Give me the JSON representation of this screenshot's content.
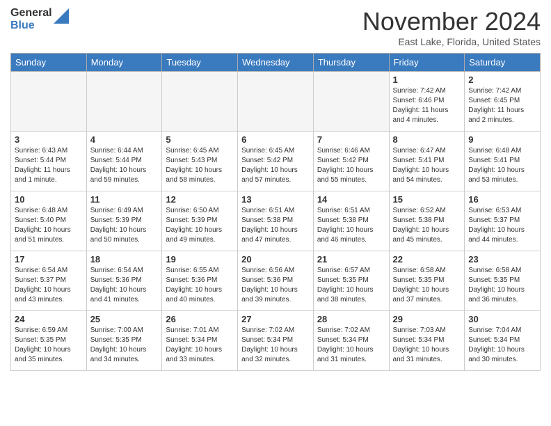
{
  "logo": {
    "general": "General",
    "blue": "Blue"
  },
  "header": {
    "month": "November 2024",
    "location": "East Lake, Florida, United States"
  },
  "days_of_week": [
    "Sunday",
    "Monday",
    "Tuesday",
    "Wednesday",
    "Thursday",
    "Friday",
    "Saturday"
  ],
  "weeks": [
    [
      {
        "day": "",
        "info": ""
      },
      {
        "day": "",
        "info": ""
      },
      {
        "day": "",
        "info": ""
      },
      {
        "day": "",
        "info": ""
      },
      {
        "day": "",
        "info": ""
      },
      {
        "day": "1",
        "info": "Sunrise: 7:42 AM\nSunset: 6:46 PM\nDaylight: 11 hours and 4 minutes."
      },
      {
        "day": "2",
        "info": "Sunrise: 7:42 AM\nSunset: 6:45 PM\nDaylight: 11 hours and 2 minutes."
      }
    ],
    [
      {
        "day": "3",
        "info": "Sunrise: 6:43 AM\nSunset: 5:44 PM\nDaylight: 11 hours and 1 minute."
      },
      {
        "day": "4",
        "info": "Sunrise: 6:44 AM\nSunset: 5:44 PM\nDaylight: 10 hours and 59 minutes."
      },
      {
        "day": "5",
        "info": "Sunrise: 6:45 AM\nSunset: 5:43 PM\nDaylight: 10 hours and 58 minutes."
      },
      {
        "day": "6",
        "info": "Sunrise: 6:45 AM\nSunset: 5:42 PM\nDaylight: 10 hours and 57 minutes."
      },
      {
        "day": "7",
        "info": "Sunrise: 6:46 AM\nSunset: 5:42 PM\nDaylight: 10 hours and 55 minutes."
      },
      {
        "day": "8",
        "info": "Sunrise: 6:47 AM\nSunset: 5:41 PM\nDaylight: 10 hours and 54 minutes."
      },
      {
        "day": "9",
        "info": "Sunrise: 6:48 AM\nSunset: 5:41 PM\nDaylight: 10 hours and 53 minutes."
      }
    ],
    [
      {
        "day": "10",
        "info": "Sunrise: 6:48 AM\nSunset: 5:40 PM\nDaylight: 10 hours and 51 minutes."
      },
      {
        "day": "11",
        "info": "Sunrise: 6:49 AM\nSunset: 5:39 PM\nDaylight: 10 hours and 50 minutes."
      },
      {
        "day": "12",
        "info": "Sunrise: 6:50 AM\nSunset: 5:39 PM\nDaylight: 10 hours and 49 minutes."
      },
      {
        "day": "13",
        "info": "Sunrise: 6:51 AM\nSunset: 5:38 PM\nDaylight: 10 hours and 47 minutes."
      },
      {
        "day": "14",
        "info": "Sunrise: 6:51 AM\nSunset: 5:38 PM\nDaylight: 10 hours and 46 minutes."
      },
      {
        "day": "15",
        "info": "Sunrise: 6:52 AM\nSunset: 5:38 PM\nDaylight: 10 hours and 45 minutes."
      },
      {
        "day": "16",
        "info": "Sunrise: 6:53 AM\nSunset: 5:37 PM\nDaylight: 10 hours and 44 minutes."
      }
    ],
    [
      {
        "day": "17",
        "info": "Sunrise: 6:54 AM\nSunset: 5:37 PM\nDaylight: 10 hours and 43 minutes."
      },
      {
        "day": "18",
        "info": "Sunrise: 6:54 AM\nSunset: 5:36 PM\nDaylight: 10 hours and 41 minutes."
      },
      {
        "day": "19",
        "info": "Sunrise: 6:55 AM\nSunset: 5:36 PM\nDaylight: 10 hours and 40 minutes."
      },
      {
        "day": "20",
        "info": "Sunrise: 6:56 AM\nSunset: 5:36 PM\nDaylight: 10 hours and 39 minutes."
      },
      {
        "day": "21",
        "info": "Sunrise: 6:57 AM\nSunset: 5:35 PM\nDaylight: 10 hours and 38 minutes."
      },
      {
        "day": "22",
        "info": "Sunrise: 6:58 AM\nSunset: 5:35 PM\nDaylight: 10 hours and 37 minutes."
      },
      {
        "day": "23",
        "info": "Sunrise: 6:58 AM\nSunset: 5:35 PM\nDaylight: 10 hours and 36 minutes."
      }
    ],
    [
      {
        "day": "24",
        "info": "Sunrise: 6:59 AM\nSunset: 5:35 PM\nDaylight: 10 hours and 35 minutes."
      },
      {
        "day": "25",
        "info": "Sunrise: 7:00 AM\nSunset: 5:35 PM\nDaylight: 10 hours and 34 minutes."
      },
      {
        "day": "26",
        "info": "Sunrise: 7:01 AM\nSunset: 5:34 PM\nDaylight: 10 hours and 33 minutes."
      },
      {
        "day": "27",
        "info": "Sunrise: 7:02 AM\nSunset: 5:34 PM\nDaylight: 10 hours and 32 minutes."
      },
      {
        "day": "28",
        "info": "Sunrise: 7:02 AM\nSunset: 5:34 PM\nDaylight: 10 hours and 31 minutes."
      },
      {
        "day": "29",
        "info": "Sunrise: 7:03 AM\nSunset: 5:34 PM\nDaylight: 10 hours and 31 minutes."
      },
      {
        "day": "30",
        "info": "Sunrise: 7:04 AM\nSunset: 5:34 PM\nDaylight: 10 hours and 30 minutes."
      }
    ]
  ]
}
